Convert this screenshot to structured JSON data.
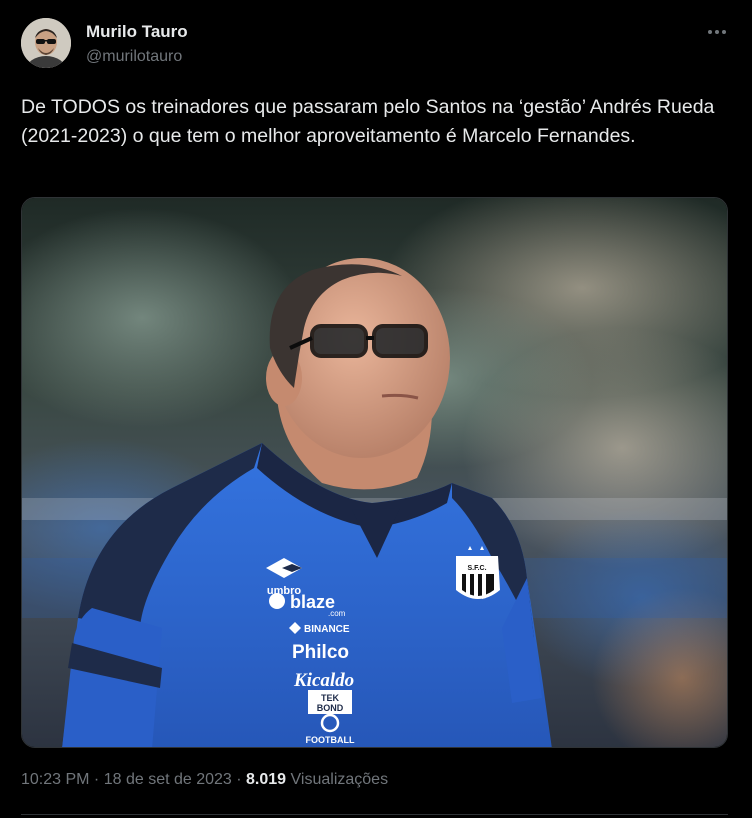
{
  "author": {
    "display_name": "Murilo Tauro",
    "handle": "@murilotauro",
    "avatar_icon": "user-avatar-icon"
  },
  "more_icon": "more-options-icon",
  "tweet": {
    "text": "De TODOS os treinadores que passaram pelo Santos na ‘gestão’  Andrés Rueda (2021-2023) o que tem o melhor aproveitamento é Marcelo Fernandes."
  },
  "photo": {
    "shirt_brand": "umbro",
    "sponsor_blaze": "blaze",
    "sponsor_blaze_tld": ".com",
    "sponsor_binance": "BINANCE",
    "sponsor_philco": "Philco",
    "sponsor_kicaldo": "Kicaldo",
    "sponsor_tekbond_top": "TEK",
    "sponsor_tekbond_bottom": "BOND",
    "sponsor_football": "FOOTBALL",
    "crest_text": "S.F.C."
  },
  "meta": {
    "time": "10:23 PM",
    "separator_1": " · ",
    "date": "18 de set de 2023",
    "separator_2": " · ",
    "views_count": "8.019",
    "views_label": " Visualizações"
  },
  "colors": {
    "background": "#000000",
    "text_primary": "#e7e9ea",
    "text_secondary": "#71767b",
    "border": "#2f3336",
    "shirt_blue": "#2f6bd8",
    "shirt_navy": "#1d2a4a"
  }
}
